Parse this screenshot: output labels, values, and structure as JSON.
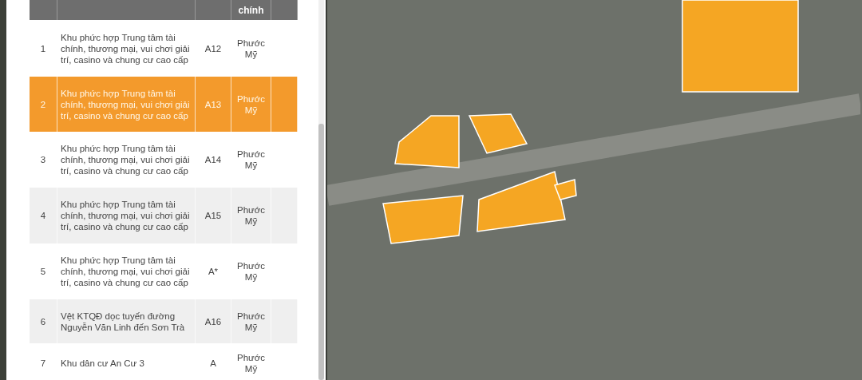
{
  "table": {
    "header": {
      "column_4": "chính"
    },
    "rows": [
      {
        "no": "1",
        "name": "Khu phức hợp Trung tâm tài chính, thương mại, vui chơi giải trí, casino và chung cư cao cấp",
        "code": "A12",
        "ward": "Phước Mỹ",
        "selected": false
      },
      {
        "no": "2",
        "name": "Khu phức hợp Trung tâm tài chính, thương mại, vui chơi giải trí, casino và chung cư cao cấp",
        "code": "A13",
        "ward": "Phước Mỹ",
        "selected": true
      },
      {
        "no": "3",
        "name": "Khu phức hợp Trung tâm tài chính, thương mại, vui chơi giải trí, casino và chung cư cao cấp",
        "code": "A14",
        "ward": "Phước Mỹ",
        "selected": false
      },
      {
        "no": "4",
        "name": "Khu phức hợp Trung tâm tài chính, thương mại, vui chơi giải trí, casino và chung cư cao cấp",
        "code": "A15",
        "ward": "Phước Mỹ",
        "selected": false
      },
      {
        "no": "5",
        "name": "Khu phức hợp Trung tâm tài chính, thương mại, vui chơi giải trí, casino và chung cư cao cấp",
        "code": "A*",
        "ward": "Phước Mỹ",
        "selected": false
      },
      {
        "no": "6",
        "name": "Vệt KTQĐ dọc tuyến đường Nguyễn Văn Linh đến Sơn Trà",
        "code": "A16",
        "ward": "Phước Mỹ",
        "selected": false
      },
      {
        "no": "7",
        "name": "Khu dân cư An Cư 3",
        "code": "A",
        "ward": "Phước Mỹ",
        "selected": false
      }
    ]
  }
}
